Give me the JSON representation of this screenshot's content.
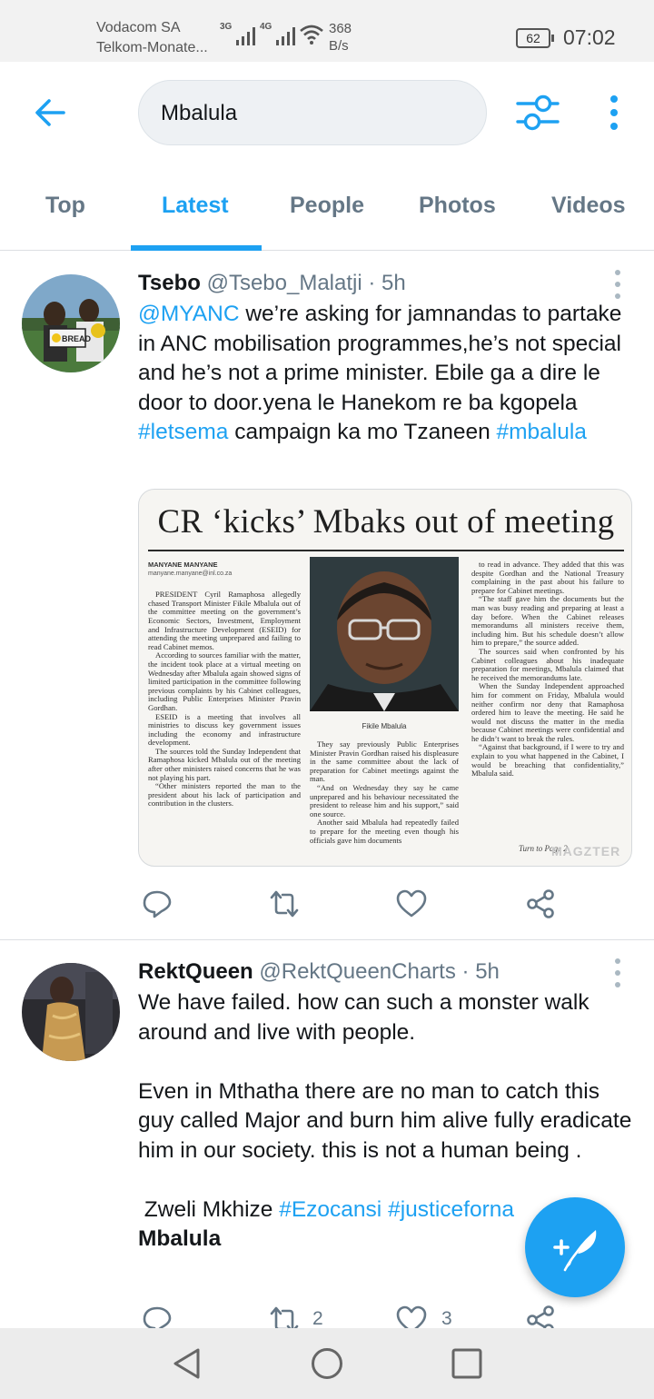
{
  "status_bar": {
    "carrier_1": "Vodacom SA",
    "carrier_2": "Telkom-Monate...",
    "signal_1_label": "3G",
    "signal_2_label": "4G",
    "speed_value": "368",
    "speed_unit": "B/s",
    "battery": "62",
    "time": "07:02"
  },
  "header": {
    "back_icon": "arrow-left-icon",
    "search_value": "Mbalula",
    "filter_icon": "sliders-icon",
    "more_icon": "more-vertical-icon"
  },
  "tabs": [
    {
      "label": "Top",
      "active": false
    },
    {
      "label": "Latest",
      "active": true
    },
    {
      "label": "People",
      "active": false
    },
    {
      "label": "Photos",
      "active": false
    },
    {
      "label": "Videos",
      "active": false
    }
  ],
  "tweets": [
    {
      "name": "Tsebo",
      "handle": "@Tsebo_Malatji",
      "sep": "·",
      "time": "5h",
      "text": {
        "mention": "@MYANC",
        "part1": " we’re asking for jamnandas to partake in ANC mobilisation programmes,he’s not special and he’s not a prime minister. Ebile ga a dire le door to door.yena le Hanekom re ba kgopela ",
        "hashtag1": "#letsema",
        "part2": " campaign ka mo Tzaneen ",
        "hashtag2": "#mbalula"
      },
      "avatar_text": "BREAD",
      "media": {
        "headline": "CR ‘kicks’ Mbaks out of meeting",
        "byline": "MANYANE MANYANE",
        "email": "manyane.manyane@inl.co.za",
        "caption": "Fikile Mbalula",
        "turn": "Turn to Page 2",
        "watermark": "MAGZTER",
        "col1": [
          "PRESIDENT Cyril Ramaphosa allegedly chased Transport Minister Fikile Mbalula out of the committee meeting on the government’s Economic Sectors, Investment, Employment and Infrastructure Development (ESEID) for attending the meeting unprepared and failing to read Cabinet memos.",
          "According to sources familiar with the matter, the incident took place at a virtual meeting on Wednesday after Mbalula again showed signs of limited participation in the committee following previous complaints by his Cabinet colleagues, including Public Enterprises Minister Pravin Gordhan.",
          "ESEID is a meeting that involves all ministries to discuss key government issues including the economy and infrastructure development.",
          "The sources told the Sunday Independent that Ramaphosa kicked Mbalula out of the meeting after other ministers raised concerns that he was not playing his part.",
          "“Other ministers reported the man to the president about his lack of participation and contribution in the clusters."
        ],
        "col2": [
          "They say previously Public Enterprises Minister Pravin Gordhan raised his displeasure in the same committee about the lack of preparation for Cabinet meetings against the man.",
          "“And on Wednesday they say he came unprepared and his behaviour necessitated the president to release him and his support,” said one source.",
          "Another said Mbalula had repeatedly failed to prepare for the meeting even though his officials gave him documents"
        ],
        "col3": [
          "to read in advance. They added that this was despite Gordhan and the National Treasury complaining in the past about his failure to prepare for Cabinet meetings.",
          "“The staff gave him the documents but the man was busy reading and preparing at least a day before. When the Cabinet releases memorandums all ministers receive them, including him. But his schedule doesn’t allow him to prepare,” the source added.",
          "The sources said when confronted by his Cabinet colleagues about his inadequate preparation for meetings, Mbalula claimed that he received the memorandums late.",
          "When the Sunday Independent approached him for comment on Friday, Mbalula would neither confirm nor deny that Ramaphosa ordered him to leave the meeting. He said he would not discuss the matter in the media because Cabinet meetings were confidential and he didn’t want to break the rules.",
          "“Against that background, if I were to try and explain to you what happened in the Cabinet, I would be breaching that confidentiality,” Mbalula said."
        ]
      },
      "actions": {
        "reply_icon": "reply-icon",
        "retweet_icon": "retweet-icon",
        "like_icon": "heart-icon",
        "share_icon": "share-icon"
      }
    },
    {
      "name": "RektQueen",
      "handle": "@RektQueenCharts",
      "sep": "·",
      "time": "5h",
      "text": {
        "para1": "We have failed. how can such a monster walk around and live with people.",
        "para2": "Even in Mthatha there are no man to catch this guy called Major and burn him alive fully eradicate him in our society. this is not a human being .",
        "para3_pre": " Zweli Mkhize ",
        "hashtag1": "#Ezocansi",
        "sp": " ",
        "hashtag2": "#justiceforna",
        "bold_end": "Mbalula"
      },
      "actions": {
        "reply_icon": "reply-icon",
        "retweet_icon": "retweet-icon",
        "retweet_count": "2",
        "like_icon": "heart-icon",
        "like_count": "3",
        "share_icon": "share-icon"
      }
    }
  ],
  "fab": {
    "icon": "compose-tweet-icon"
  },
  "nav_bar": {
    "back_icon": "triangle-back-icon",
    "home_icon": "circle-home-icon",
    "recents_icon": "square-recents-icon"
  },
  "colors": {
    "accent": "#1da1f2",
    "text": "#14171a",
    "secondary": "#657786"
  }
}
